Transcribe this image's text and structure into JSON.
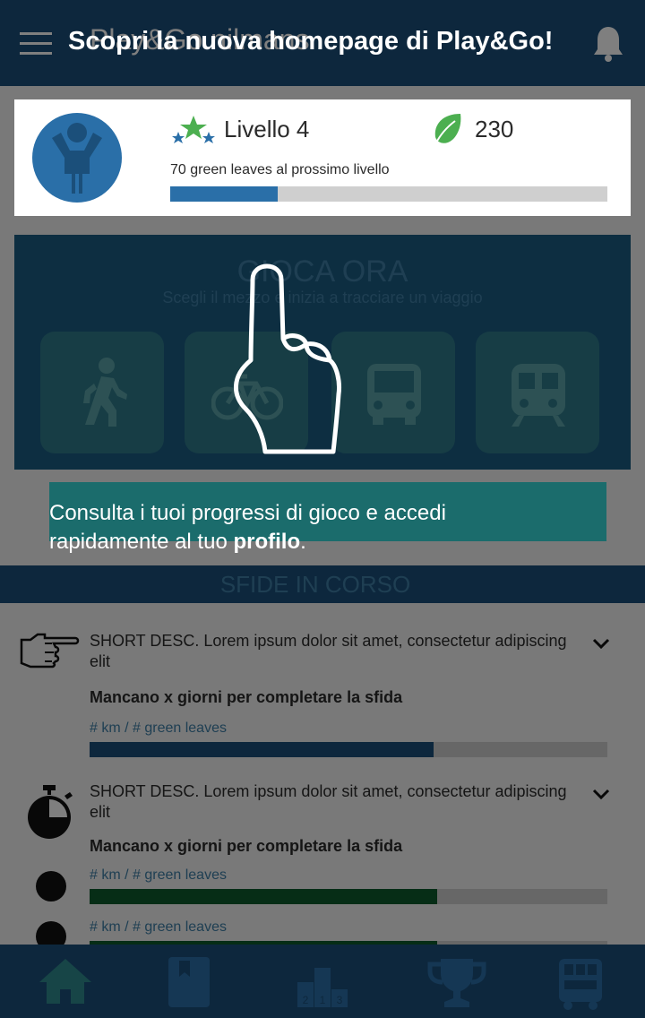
{
  "app": {
    "title": "Play&Go nilmans"
  },
  "profile": {
    "level_label": "Livello 4",
    "points": "230",
    "next_level_text": "70 green leaves al prossimo livello",
    "progress_fraction": 0.245
  },
  "play": {
    "title": "GIOCA ORA",
    "subtitle": "Scegli il mezzo e inizia a tracciare un viaggio",
    "modes": [
      "walk-icon",
      "bike-icon",
      "bus-icon",
      "train-icon"
    ]
  },
  "challenges": {
    "section_title": "SFIDE IN CORSO",
    "items": [
      {
        "icon": "pointing-hand-icon",
        "desc": "SHORT DESC. Lorem ipsum dolor sit amet, consectetur adipiscing elit",
        "remaining": "Mancano x giorni per completare la sfida",
        "metric": "# km / # green leaves",
        "progress": 0.665,
        "color": "#1b4f7a"
      },
      {
        "icon": "stopwatch-icon",
        "desc": "SHORT DESC. Lorem ipsum dolor sit amet, consectetur adipiscing elit",
        "remaining": "Mancano x giorni per completare la sfida",
        "metric": "# km / # green leaves",
        "progress": 0.672,
        "color": "#0c5a2c"
      },
      {
        "metric": "# km / # green leaves",
        "progress": 0.672,
        "color": "#0c5a2c"
      }
    ]
  },
  "tour": {
    "title": "Scopri la nuova homepage  di Play&Go!",
    "text_before": "Consulta i tuoi progressi di gioco e accedi rapidamente al tuo ",
    "text_bold": "profilo",
    "text_after": "."
  },
  "nav": {
    "items": [
      "home-icon",
      "diary-icon",
      "ranking-icon",
      "trophy-icon",
      "transport-icon"
    ]
  },
  "colors": {
    "primary": "#1b4f7a",
    "accent": "#2a6fa8",
    "green": "#4caf50"
  }
}
